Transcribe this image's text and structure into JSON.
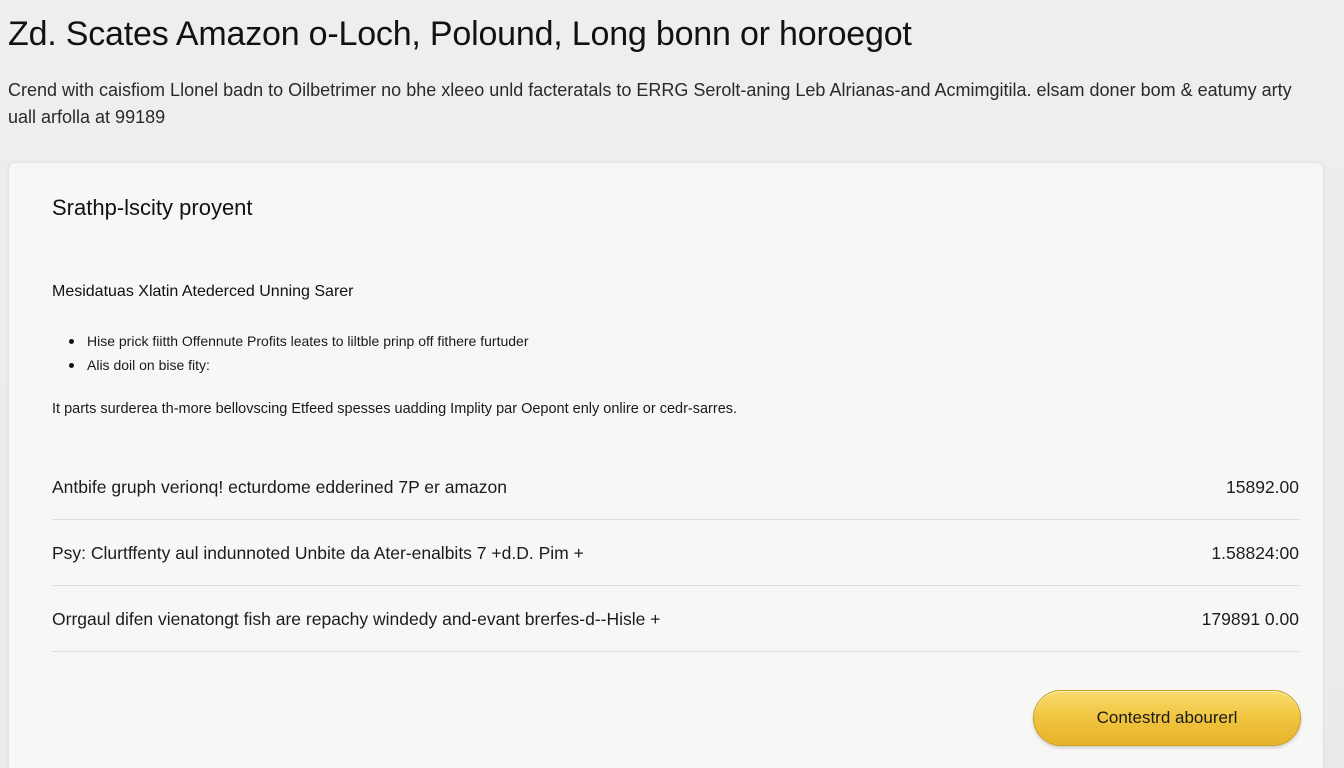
{
  "header": {
    "title": "Zd. Scates Amazon o-Loch, Polound, Long bonn or horoegot",
    "subtitle": "Crend with caisfiom Llonel badn to Oilbetrimer no bhe xleeo unld facteratals to ERRG Serolt-aning Leb Alrianas-and Acmimgitila. elsam doner bom & eatumy arty uall arfolla at 99189"
  },
  "card": {
    "title": "Srathp-lscity proyent",
    "section_heading": "Mesidatuas Xlatin Atederced Unning Sarer",
    "bullets": [
      "Hise prick fiitth Offennute Profits leates to liltble prinp off fithere furtuder",
      "Alis doil on bise fity:"
    ],
    "description": "It parts surderea th-more bellovscing Etfeed spesses uadding Implity par Oepont enly onlire or cedr-sarres.",
    "rows": [
      {
        "label": "Antbife gruph verionq! ecturdome edderined 7P er amazon",
        "value": "15892.00"
      },
      {
        "label": "Psy: Clurtffenty aul indunnoted Unbite da Ater-enalbits 7 +d.D. Pim +",
        "value": "1.58824:00"
      },
      {
        "label": "Orrgaul difen vienatongt fish are repachy windedy and-evant brerfes-d--Hisle +",
        "value": "179891 0.00"
      }
    ],
    "button_label": "Contestrd abourerl"
  },
  "colors": {
    "page_background": "#ececea",
    "card_background": "#f7f7f6",
    "button_gold": "#f0c43e"
  }
}
